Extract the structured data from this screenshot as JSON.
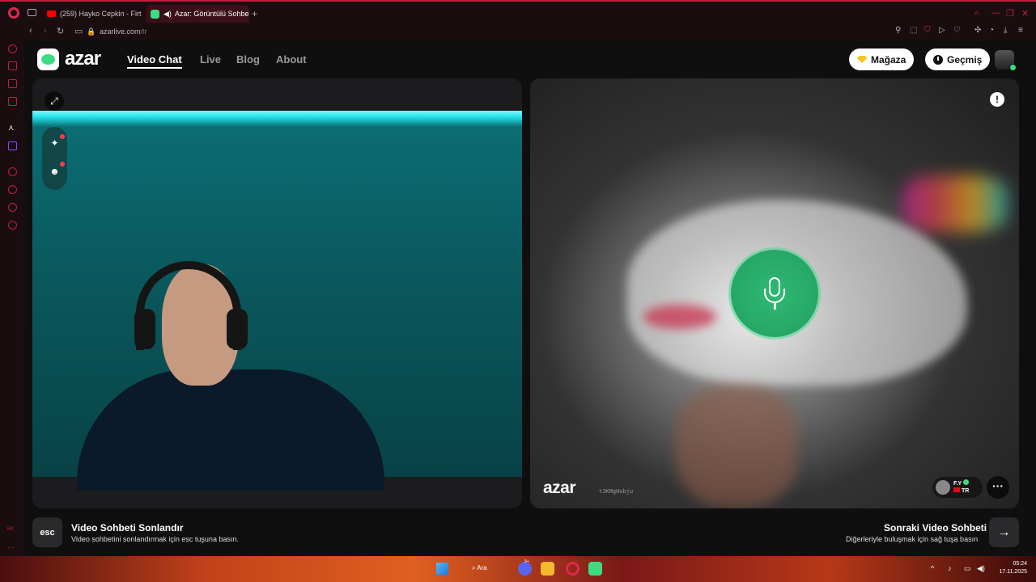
{
  "browser": {
    "tabs": [
      {
        "title": "(259) Hayko Cepkin - Firt",
        "active": false
      },
      {
        "title": "Azar: Görüntülü Sohbe",
        "active": true
      }
    ],
    "url_host": "azarlive.com",
    "url_path": "/tr",
    "accent_color": "#c0203a",
    "sidebar_label": "EK"
  },
  "header": {
    "logo": "azar",
    "nav": [
      "Video Chat",
      "Live",
      "Blog",
      "About"
    ],
    "active_nav": "Video Chat",
    "store_label": "Mağaza",
    "history_label": "Geçmiş"
  },
  "peer": {
    "watermark": "azar",
    "user_id": "t3KMgHxbju",
    "name": "F.Y",
    "country": "TR"
  },
  "footer": {
    "esc_key": "esc",
    "end_title": "Video Sohbeti Sonlandır",
    "end_sub": "Video sohbetini sonlandırmak için esc tuşuna basın.",
    "next_title": "Sonraki Video Sohbeti",
    "next_sub": "Diğerleriyle buluşmak için sağ tuşa basın",
    "next_key": "→"
  },
  "taskbar": {
    "search_label": "Ara",
    "time": "05:24",
    "date": "17.11.2025",
    "notif_count": "9+"
  },
  "colors": {
    "brand_green": "#3ddc84",
    "mic_green": "#26a865",
    "store_gem": "#f7c41c"
  }
}
